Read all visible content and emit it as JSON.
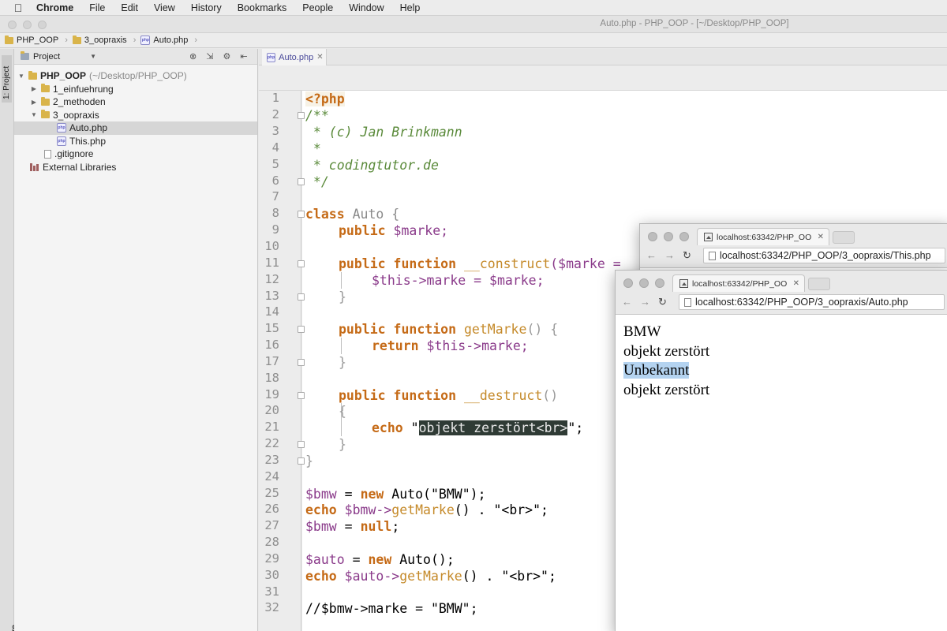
{
  "menubar": {
    "app": "Chrome",
    "items": [
      "File",
      "Edit",
      "View",
      "History",
      "Bookmarks",
      "People",
      "Window",
      "Help"
    ]
  },
  "ide": {
    "title": "Auto.php - PHP_OOP - [~/Desktop/PHP_OOP]",
    "breadcrumbs": [
      "PHP_OOP",
      "3_oopraxis",
      "Auto.php"
    ],
    "left_strip": {
      "project_tab": "1: Project",
      "structure_tab": "Z: Structure"
    },
    "project_panel": {
      "selector": "Project",
      "tree": {
        "root_name": "PHP_OOP",
        "root_path": "(~/Desktop/PHP_OOP)",
        "folder1": "1_einfuehrung",
        "folder2": "2_methoden",
        "folder3": "3_oopraxis",
        "file_auto": "Auto.php",
        "file_this": "This.php",
        "gitignore": ".gitignore",
        "libraries": "External Libraries"
      }
    },
    "editor_tab": "Auto.php",
    "line_numbers": [
      "1",
      "2",
      "3",
      "4",
      "5",
      "6",
      "7",
      "8",
      "9",
      "10",
      "11",
      "12",
      "13",
      "14",
      "15",
      "16",
      "17",
      "18",
      "19",
      "20",
      "21",
      "22",
      "23",
      "24",
      "25",
      "26",
      "27",
      "28",
      "29",
      "30",
      "31",
      "32"
    ],
    "code": {
      "php_open": "<?php",
      "doc_open": "/**",
      "doc_author": " * (c) Jan Brinkmann",
      "doc_star": " *",
      "doc_site": " * codingtutor.de",
      "doc_close": " */",
      "kw_class": "class",
      "class_name": " Auto {",
      "kw_public": "public",
      "prop_marke": " $marke;",
      "kw_function": " function ",
      "fn_construct": "__construct",
      "construct_args": "($marke = ",
      "this_marke": "$this->marke = ",
      "var_marke": "$marke;",
      "brace_close": "}",
      "fn_getmarke": "getMarke",
      "parens_open": "() {",
      "kw_return": "return",
      "return_rest": " $this->marke;",
      "fn_destruct": "__destruct",
      "parens": "()",
      "brace_open": "{",
      "kw_echo": "echo",
      "quote_open": " \"",
      "echo_string": "objekt zerstört<br>",
      "quote_close": "\";",
      "class_close": "}",
      "l25_var": "$bmw",
      "l25_eq": " = ",
      "kw_new": "new",
      "l25_rest": " Auto(\"BMW\");",
      "l26_var": " $bmw->",
      "l26_fn": "getMarke",
      "l26_rest": "() . \"<br>\";",
      "l27_var": "$bmw",
      "l27_eq": " = ",
      "kw_null": "null",
      "semicolon": ";",
      "l29_var": "$auto",
      "l29_eq": " = ",
      "l29_rest": " Auto();",
      "l30_var": " $auto->",
      "l30_fn": "getMarke",
      "l30_rest": "() . \"<br>\";",
      "l32": "//$bmw->marke = \"BMW\";"
    }
  },
  "browser_back": {
    "tab_title": "localhost:63342/PHP_OO",
    "url": "localhost:63342/PHP_OOP/3_oopraxis/This.php"
  },
  "browser_front": {
    "tab_title": "localhost:63342/PHP_OO",
    "url": "localhost:63342/PHP_OOP/3_oopraxis/Auto.php",
    "output": [
      "BMW",
      "objekt zerstört",
      "Unbekannt",
      "objekt zerstört"
    ]
  },
  "colors": {
    "keyword": "#c56a16",
    "comment": "#5a8a3a",
    "variable": "#8a3a8a",
    "selection": "#b4d3f0"
  }
}
